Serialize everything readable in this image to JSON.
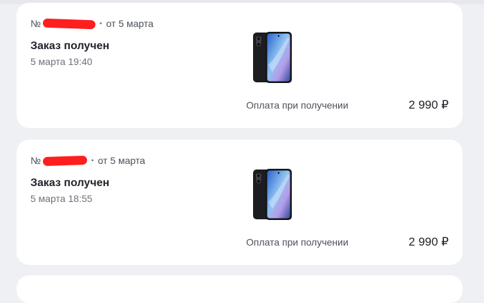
{
  "orders": [
    {
      "number_prefix": "№",
      "separator": "•",
      "date": "от 5 марта",
      "status": "Заказ получен",
      "status_time": "5 марта 19:40",
      "payment": "Оплата при получении",
      "price": "2 990 ₽",
      "product_icon": "smartphone-icon"
    },
    {
      "number_prefix": "№",
      "separator": "•",
      "date": "от 5 марта",
      "status": "Заказ получен",
      "status_time": "5 марта 18:55",
      "payment": "Оплата при получении",
      "price": "2 990 ₽",
      "product_icon": "smartphone-icon"
    }
  ],
  "colors": {
    "background": "#eef0f4",
    "card": "#ffffff",
    "redaction": "#ff1e1e",
    "phone_body": "#1c1d21",
    "phone_screen": "#5f8fd8"
  }
}
